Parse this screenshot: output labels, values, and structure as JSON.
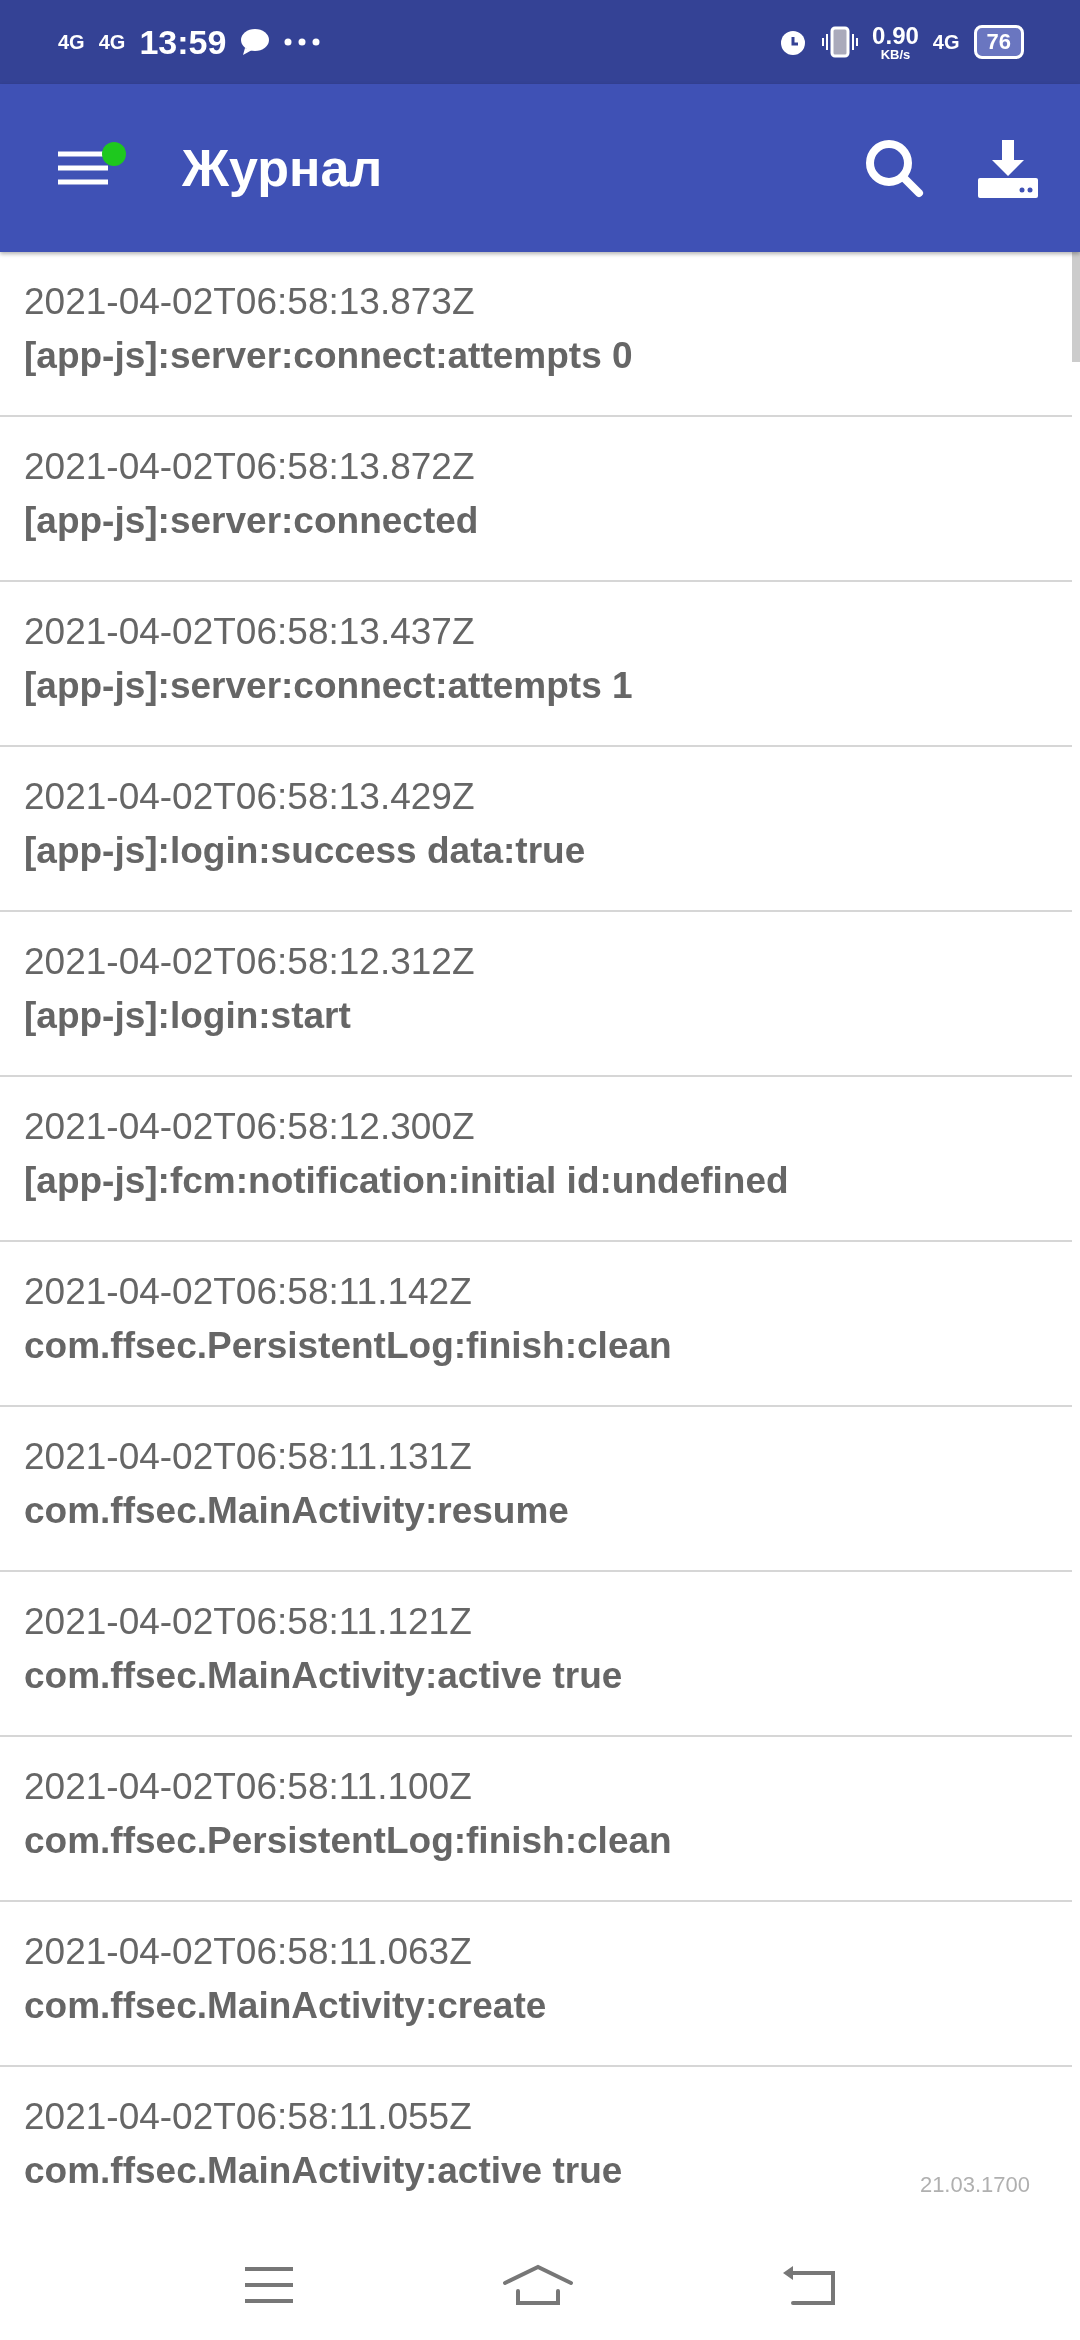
{
  "status_bar": {
    "network_1": "4G",
    "network_2": "4G",
    "time": "13:59",
    "speed": "0.90",
    "speed_unit": "KB/s",
    "network_3": "4G",
    "battery": "76"
  },
  "app_bar": {
    "title": "Журнал",
    "menu_badge": true
  },
  "log_entries": [
    {
      "timestamp": "2021-04-02T06:58:13.873Z",
      "message": "[app-js]:server:connect:attempts 0"
    },
    {
      "timestamp": "2021-04-02T06:58:13.872Z",
      "message": "[app-js]:server:connected"
    },
    {
      "timestamp": "2021-04-02T06:58:13.437Z",
      "message": "[app-js]:server:connect:attempts 1"
    },
    {
      "timestamp": "2021-04-02T06:58:13.429Z",
      "message": "[app-js]:login:success data:true"
    },
    {
      "timestamp": "2021-04-02T06:58:12.312Z",
      "message": "[app-js]:login:start"
    },
    {
      "timestamp": "2021-04-02T06:58:12.300Z",
      "message": "[app-js]:fcm:notification:initial id:undefined"
    },
    {
      "timestamp": "2021-04-02T06:58:11.142Z",
      "message": "com.ffsec.PersistentLog:finish:clean"
    },
    {
      "timestamp": "2021-04-02T06:58:11.131Z",
      "message": "com.ffsec.MainActivity:resume"
    },
    {
      "timestamp": "2021-04-02T06:58:11.121Z",
      "message": "com.ffsec.MainActivity:active true"
    },
    {
      "timestamp": "2021-04-02T06:58:11.100Z",
      "message": "com.ffsec.PersistentLog:finish:clean"
    },
    {
      "timestamp": "2021-04-02T06:58:11.063Z",
      "message": "com.ffsec.MainActivity:create"
    },
    {
      "timestamp": "2021-04-02T06:58:11.055Z",
      "message": "com.ffsec.MainActivity:active true"
    }
  ],
  "version": "21.03.1700"
}
